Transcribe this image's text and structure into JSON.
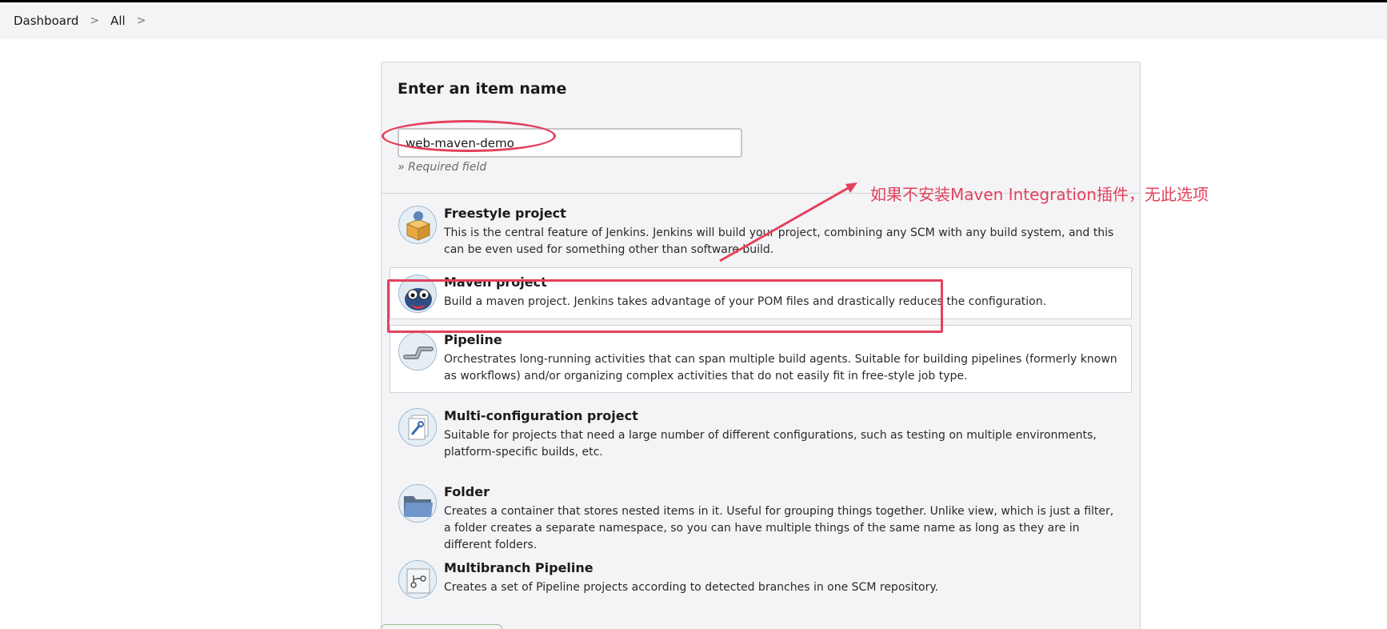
{
  "breadcrumb": [
    {
      "label": "Dashboard"
    },
    {
      "label": "All"
    }
  ],
  "breadcrumb_separator": ">",
  "form": {
    "title": "Enter an item name",
    "item_name_value": "web-maven-demo",
    "required_note": "» Required field"
  },
  "items": [
    {
      "title": "Freestyle project",
      "icon": "freestyle-project-icon",
      "description": "This is the central feature of Jenkins. Jenkins will build your project, combining any SCM with any build system, and this can be even used for something other than software build."
    },
    {
      "title": "Maven project",
      "icon": "maven-project-icon",
      "description": "Build a maven project. Jenkins takes advantage of your POM files and drastically reduces the configuration."
    },
    {
      "title": "Pipeline",
      "icon": "pipeline-icon",
      "description": "Orchestrates long-running activities that can span multiple build agents. Suitable for building pipelines (formerly known as workflows) and/or organizing complex activities that do not easily fit in free-style job type."
    },
    {
      "title": "Multi-configuration project",
      "icon": "multi-configuration-icon",
      "description": "Suitable for projects that need a large number of different configurations, such as testing on multiple environments, platform-specific builds, etc."
    },
    {
      "title": "Folder",
      "icon": "folder-icon",
      "description": "Creates a container that stores nested items in it. Useful for grouping things together. Unlike view, which is just a filter, a folder creates a separate namespace, so you can have multiple things of the same name as long as they are in different folders."
    },
    {
      "title": "Multibranch Pipeline",
      "icon": "multibranch-pipeline-icon",
      "description": "Creates a set of Pipeline projects according to detected branches in one SCM repository."
    }
  ],
  "annotation": {
    "text": "如果不安装Maven Integration插件，无此选项",
    "color": "#e4415c"
  }
}
